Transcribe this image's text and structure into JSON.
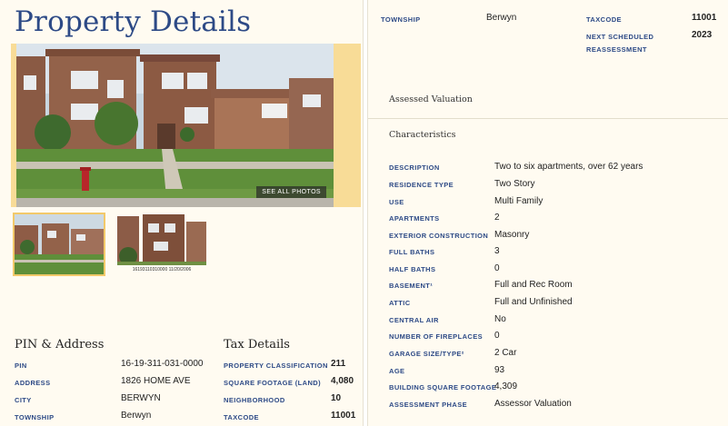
{
  "page_title": "Property Details",
  "hero": {
    "see_all_label": "SEE ALL PHOTOS"
  },
  "thumbs": [
    {
      "caption": ""
    },
    {
      "caption": "16193110310000 11/20/2006"
    }
  ],
  "pin_address": {
    "title": "PIN & Address",
    "rows": [
      {
        "label": "PIN",
        "value": "16-19-311-031-0000"
      },
      {
        "label": "ADDRESS",
        "value": "1826 HOME AVE"
      },
      {
        "label": "CITY",
        "value": "BERWYN"
      },
      {
        "label": "TOWNSHIP",
        "value": "Berwyn"
      }
    ]
  },
  "tax_details": {
    "title": "Tax Details",
    "rows": [
      {
        "label": "PROPERTY CLASSIFICATION",
        "value": "211"
      },
      {
        "label": "SQUARE FOOTAGE (LAND)",
        "value": "4,080"
      },
      {
        "label": "NEIGHBORHOOD",
        "value": "10"
      },
      {
        "label": "TAXCODE",
        "value": "11001"
      }
    ]
  },
  "right_top": {
    "township_label": "TOWNSHIP",
    "township_value": "Berwyn",
    "taxcode_label": "TAXCODE",
    "taxcode_value": "11001",
    "reassessment_label_1": "NEXT SCHEDULED",
    "reassessment_label_2": "REASSESSMENT",
    "reassessment_value": "2023"
  },
  "assessed_valuation": {
    "title": "Assessed Valuation"
  },
  "characteristics": {
    "title": "Characteristics",
    "rows": [
      {
        "label": "DESCRIPTION",
        "value": "Two to six apartments, over 62 years"
      },
      {
        "label": "RESIDENCE TYPE",
        "value": "Two Story"
      },
      {
        "label": "USE",
        "value": "Multi Family"
      },
      {
        "label": "APARTMENTS",
        "value": "2"
      },
      {
        "label": "EXTERIOR CONSTRUCTION",
        "value": "Masonry"
      },
      {
        "label": "FULL BATHS",
        "value": "3"
      },
      {
        "label": "HALF BATHS",
        "value": "0"
      },
      {
        "label": "BASEMENT¹",
        "value": "Full and Rec Room"
      },
      {
        "label": "ATTIC",
        "value": "Full and Unfinished"
      },
      {
        "label": "CENTRAL AIR",
        "value": "No"
      },
      {
        "label": "NUMBER OF FIREPLACES",
        "value": "0"
      },
      {
        "label": "GARAGE SIZE/TYPE²",
        "value": "2 Car"
      },
      {
        "label": "AGE",
        "value": "93"
      },
      {
        "label": "BUILDING SQUARE FOOTAGE",
        "value": "4,309"
      },
      {
        "label": "ASSESSMENT PHASE",
        "value": "Assessor Valuation"
      }
    ]
  },
  "colors": {
    "accent": "#2d4a86",
    "panel_bg": "#fffbf1",
    "hero_bg": "#f8dc97"
  }
}
